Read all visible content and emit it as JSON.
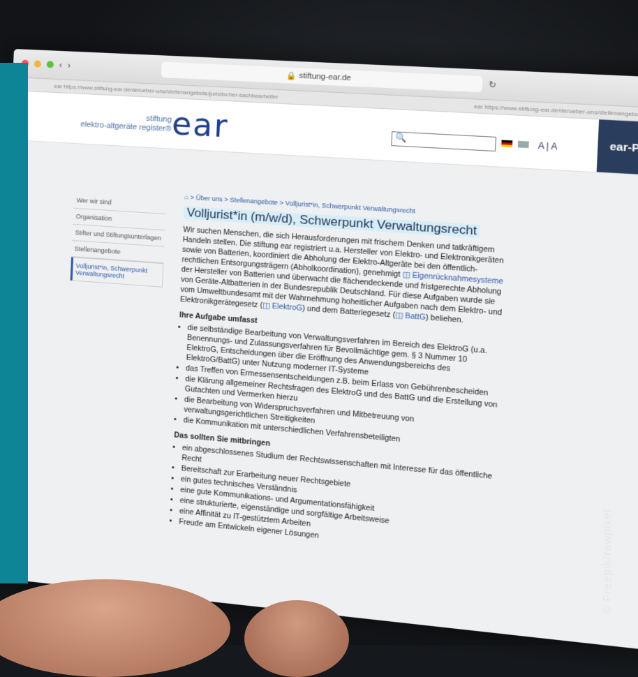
{
  "browser": {
    "address": "stiftung-ear.de",
    "url_left": "ear https://www.stiftung-ear.de/de/ueber-uns/stellenangebote/juristischer-sachbearbeiter",
    "url_right": "ear https://www.stiftung-ear.de/de/ueber-uns/stellenangebote/volljurist-in-ver"
  },
  "header": {
    "logo_small_1": "stiftung",
    "logo_small_2": "elektro-altgeräte register®",
    "logo_main": "ear",
    "search_value": "",
    "lang_label": "A | A",
    "portal_button": "ear-Portal"
  },
  "sidebar": {
    "items": [
      {
        "label": "Wer wir sind"
      },
      {
        "label": "Organisation"
      },
      {
        "label": "Stifter und Stiftungsunterlagen"
      },
      {
        "label": "Stellenangebote"
      },
      {
        "label": "Volljurist*in, Schwerpunkt Verwaltungsrecht"
      }
    ]
  },
  "content": {
    "breadcrumb": "> Über uns > Stellenangebote > Volljurist*in, Schwerpunkt Verwaltungsrecht",
    "title": "Volljurist*in (m/w/d), Schwerpunkt Verwaltungsrecht",
    "intro": "Wir suchen Menschen, die sich Herausforderungen mit frischem Denken und tatkräftigem Handeln stellen. Die stiftung ear registriert u.a. Hersteller von Elektro- und Elektronikgeräten sowie von Batterien, koordiniert die Abholung der Elektro-Altgeräte bei den öffentlich-rechtlichen Entsorgungsträgern (Abholkoordination), genehmigt",
    "intro_link": "Eigenrücknahmesysteme",
    "intro_2": "der Hersteller von Batterien und überwacht die flächendeckende und fristgerechte Abholung von Geräte-Altbatterien in der Bundesrepublik Deutschland. Für diese Aufgaben wurde sie vom Umweltbundesamt mit der Wahrnehmung hoheitlicher Aufgaben nach dem Elektro- und Elektronikgerätegesetz (",
    "link_elektrog": "ElektroG",
    "intro_3": ") und dem Batteriegesetz (",
    "link_battg": "BattG",
    "intro_4": ") beliehen.",
    "heading_1": "Ihre Aufgabe umfasst",
    "tasks": [
      "die selbständige Bearbeitung von Verwaltungsverfahren im Bereich des ElektroG (u.a. Benennungs- und Zulassungsverfahren für Bevollmächtige gem. § 3 Nummer 10 ElektroG, Entscheidungen über die Eröffnung des Anwendungsbereichs des ElektroG/BattG) unter Nutzung moderner IT-Systeme",
      "das Treffen von Ermessensentscheidungen z.B. beim Erlass von Gebührenbescheiden",
      "die Klärung allgemeiner Rechtsfragen des ElektroG und des BattG und die Erstellung von Gutachten und Vermerken hierzu",
      "die Bearbeitung von Widerspruchsverfahren und Mitbetreuung von verwaltungsgerichtlichen Streitigkeiten",
      "die Kommunikation mit unterschiedlichen Verfahrensbeteiligten"
    ],
    "heading_2": "Das sollten Sie mitbringen",
    "requirements": [
      "ein abgeschlossenes Studium der Rechtswissenschaften mit Interesse für das öffentliche Recht",
      "Bereitschaft zur Erarbeitung neuer Rechtsgebiete",
      "ein gutes technisches Verständnis",
      "eine gute Kommunikations- und Argumentationsfähigkeit",
      "eine strukturierte, eigenständige und sorgfältige Arbeitsweise",
      "eine Affinität zu IT-gestütztem Arbeiten",
      "Freude am Entwickeln eigener Lösungen"
    ]
  },
  "credit": "© Freepik/rawpixel"
}
